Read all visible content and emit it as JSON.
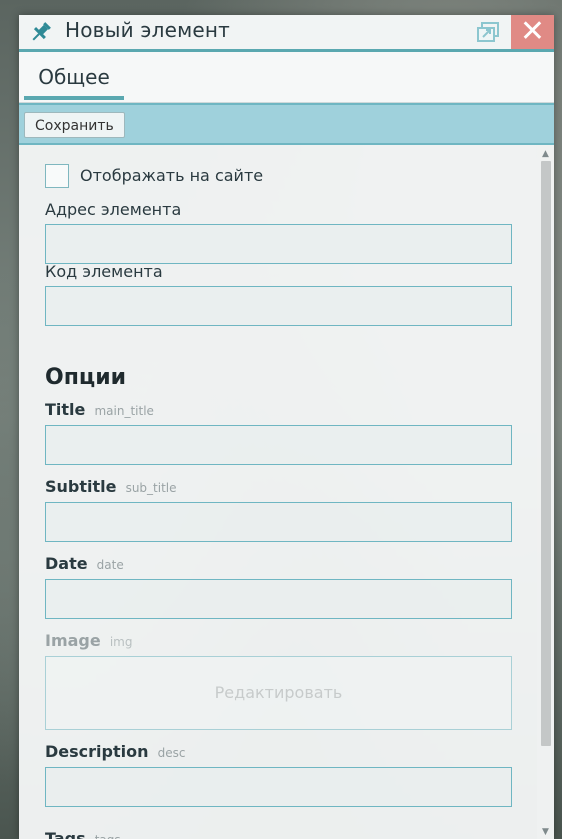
{
  "window": {
    "title": "Новый элемент",
    "close_label": "✕"
  },
  "tabs": [
    {
      "label": "Общее"
    }
  ],
  "toolbar": {
    "save_label": "Сохранить"
  },
  "form": {
    "show_on_site": {
      "label": "Отображать на сайте",
      "checked": false
    },
    "address": {
      "label": "Адрес элемента",
      "value": ""
    },
    "code": {
      "label": "Код элемента",
      "value": ""
    },
    "options_title": "Опции",
    "options": [
      {
        "label": "Title",
        "key": "main_title",
        "value": ""
      },
      {
        "label": "Subtitle",
        "key": "sub_title",
        "value": ""
      },
      {
        "label": "Date",
        "key": "date",
        "value": ""
      },
      {
        "label": "Image",
        "key": "img",
        "edit_label": "Редактировать"
      },
      {
        "label": "Description",
        "key": "desc",
        "value": ""
      },
      {
        "label": "Tags",
        "key": "tags"
      }
    ]
  },
  "colors": {
    "accent": "#5aa8b0",
    "toolbar_bg": "#9fd1dc",
    "close_bg": "#e08a85"
  },
  "icons": {
    "pin": "pushpin-icon",
    "popout": "popout-window-icon",
    "close": "close-icon"
  }
}
